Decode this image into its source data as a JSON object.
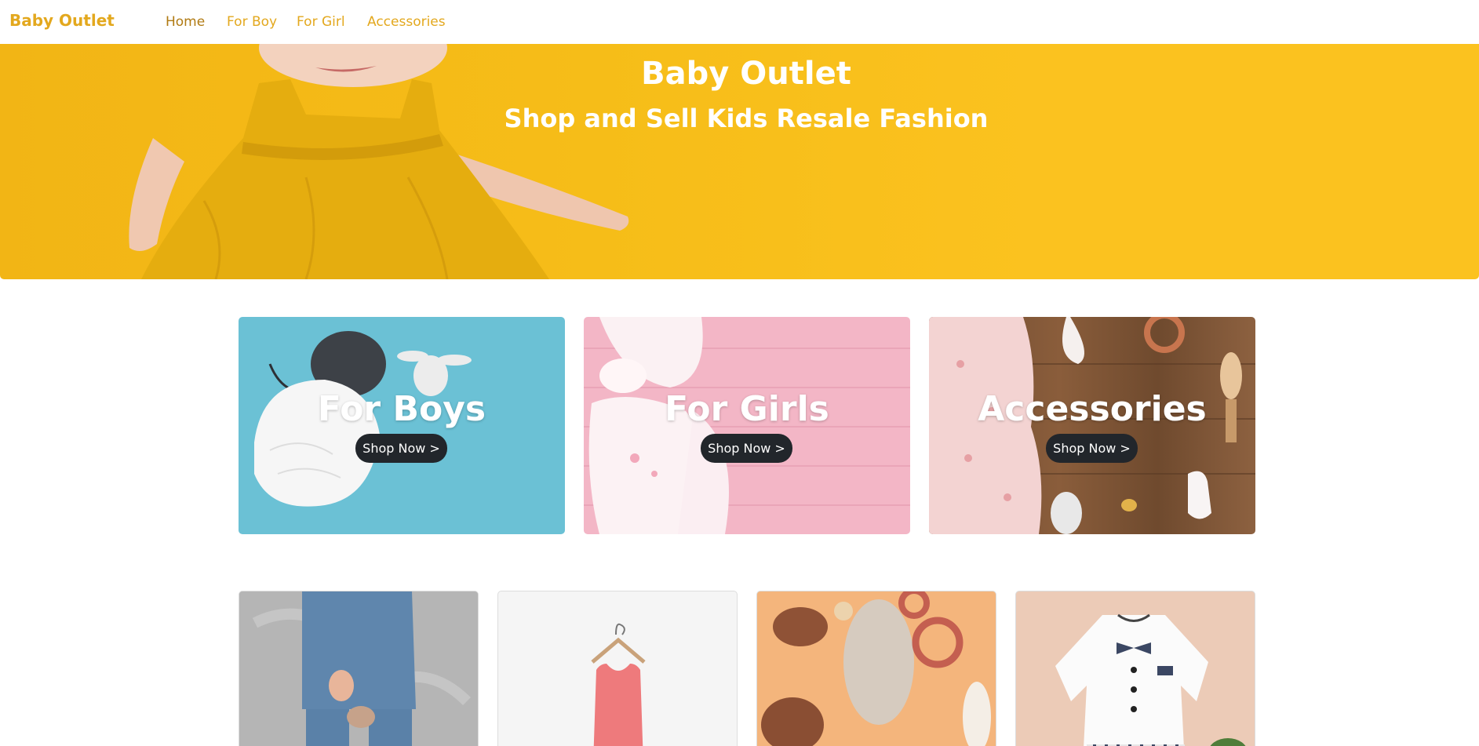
{
  "nav": {
    "brand": "Baby Outlet",
    "links": [
      "Home",
      "For Boy",
      "For Girl",
      "Accessories"
    ],
    "active_index": 0
  },
  "hero": {
    "title": "Baby Outlet",
    "subtitle": "Shop and Sell Kids Resale Fashion"
  },
  "categories": [
    {
      "title": "For Boys",
      "button": "Shop Now >"
    },
    {
      "title": "For Girls",
      "button": "Shop Now >"
    },
    {
      "title": "Accessories",
      "button": "Shop Now >"
    }
  ],
  "colors": {
    "brand": "#e3a81e",
    "hero": "#f6bd18",
    "button": "#22262b",
    "boys_bg": "#6bc1d5",
    "girls_bg": "#f3b6c6"
  }
}
